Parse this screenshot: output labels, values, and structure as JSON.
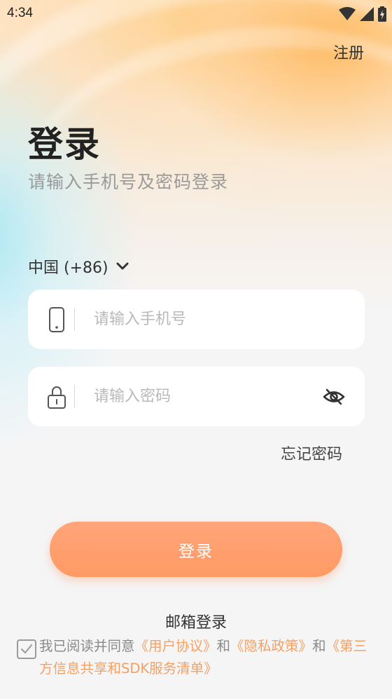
{
  "status_bar": {
    "time": "4:34"
  },
  "header": {
    "register_label": "注册"
  },
  "main": {
    "title": "登录",
    "subtitle": "请输入手机号及密码登录",
    "country_code": "中国 (+86)",
    "phone_input": {
      "value": "",
      "placeholder": "请输入手机号"
    },
    "password_input": {
      "value": "",
      "placeholder": "请输入密码"
    },
    "forgot_password": "忘记密码",
    "login_button": "登录",
    "email_login": "邮箱登录"
  },
  "agreement": {
    "prefix": "我已阅读并同意",
    "user_agreement": "《用户协议》",
    "and_1": "和",
    "privacy_policy": "《隐私政策》",
    "and_2": "和",
    "third_party": "《第三方信息共享和SDK服务清单》",
    "checked": false
  },
  "colors": {
    "accent": "#ff9a64",
    "link": "#f6a064"
  },
  "icons": {
    "phone": "phone-icon",
    "lock": "lock-icon",
    "eye_hidden": "eye-off-icon",
    "chevron": "chevron-down-icon"
  }
}
